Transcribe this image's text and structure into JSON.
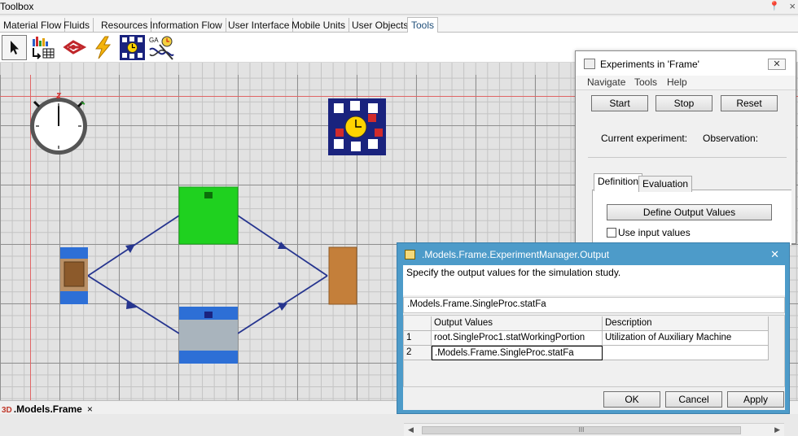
{
  "toolbox": {
    "title": "Toolbox",
    "pin": "📍",
    "close": "×"
  },
  "tabs": [
    {
      "label": "Material Flow"
    },
    {
      "label": "Fluids"
    },
    {
      "label": "Resources"
    },
    {
      "label": "Information Flow"
    },
    {
      "label": "User Interface"
    },
    {
      "label": "Mobile Units"
    },
    {
      "label": "User Objects"
    },
    {
      "label": "Tools"
    }
  ],
  "tools": [
    {
      "name": "pointer-tool-icon"
    },
    {
      "name": "chart-table-icon"
    },
    {
      "name": "method-icon"
    },
    {
      "name": "lightning-icon"
    },
    {
      "name": "experiment-manager-icon"
    },
    {
      "name": "genetic-algorithm-icon"
    }
  ],
  "canvas": {
    "frame_tab": ".Models.Frame",
    "frame_tab_badge": "3D",
    "frame_tab_close": "×"
  },
  "experiments": {
    "title": "Experiments in  'Frame'",
    "menu": [
      "Navigate",
      "Tools",
      "Help"
    ],
    "start": "Start",
    "stop": "Stop",
    "reset": "Reset",
    "current_experiment": "Current experiment:",
    "observation": "Observation:",
    "tab_definition": "Definition",
    "tab_evaluation": "Evaluation",
    "define_output": "Define Output Values",
    "use_input": "Use input values"
  },
  "output_dialog": {
    "title": ".Models.Frame.ExperimentManager.Output",
    "description": "Specify the output values for the simulation study.",
    "path": ".Models.Frame.SingleProc.statFa",
    "headers": [
      "Output Values",
      "Description"
    ],
    "rows": [
      {
        "n": "1",
        "value": "root.SingleProc1.statWorkingPortion",
        "desc": "Utilization of Auxiliary Machine"
      },
      {
        "n": "2",
        "value": ".Models.Frame.SingleProc.statFa",
        "desc": ""
      }
    ],
    "ok": "OK",
    "cancel": "Cancel",
    "apply": "Apply",
    "scroll_grip": "III"
  },
  "colors": {
    "green_proc": "#1fd11f",
    "blue_station": "#2d6fd6",
    "connector": "#26358f",
    "dialog_title": "#4d9bc9"
  }
}
